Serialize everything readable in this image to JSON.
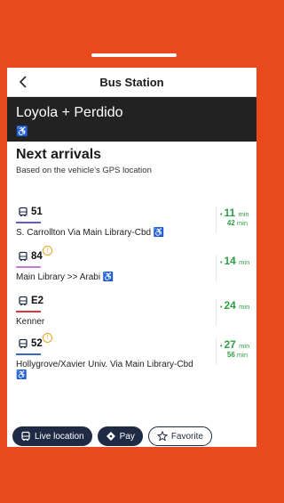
{
  "header": {
    "title": "Bus Station"
  },
  "stop": {
    "name": "Loyola + Perdido",
    "accessible_icon": "♿"
  },
  "arrivals": {
    "title": "Next arrivals",
    "subtitle": "Based on the vehicle's GPS location",
    "items": [
      {
        "route": "51",
        "color": "#5b5fc7",
        "warning": false,
        "destination": "S. Carrollton Via Main Library-Cbd ♿",
        "eta": "11",
        "unit": "min",
        "next": "42",
        "next_unit": "min"
      },
      {
        "route": "84",
        "color": "#c77bd9",
        "warning": true,
        "destination": "Main Library >> Arabi ♿",
        "eta": "14",
        "unit": "min"
      },
      {
        "route": "E2",
        "color": "#d9363e",
        "warning": false,
        "destination": "Kenner",
        "eta": "24",
        "unit": "min"
      },
      {
        "route": "52",
        "color": "#3a66c4",
        "warning": true,
        "destination": "Hollygrove/Xavier Univ. Via Main Library-Cbd ♿",
        "eta": "27",
        "unit": "min",
        "next": "56",
        "next_unit": "min"
      }
    ]
  },
  "actions": {
    "live_location": "Live location",
    "pay": "Pay",
    "favorite": "Favorite"
  },
  "colors": {
    "background": "#e84a1e",
    "banner": "#222222",
    "eta": "#2ea043",
    "button": "#1f2a44"
  },
  "icons": {
    "back": "chevron-left-icon",
    "bus": "bus-icon",
    "warning": "warning-icon",
    "pay": "ticket-icon",
    "star": "star-icon"
  }
}
